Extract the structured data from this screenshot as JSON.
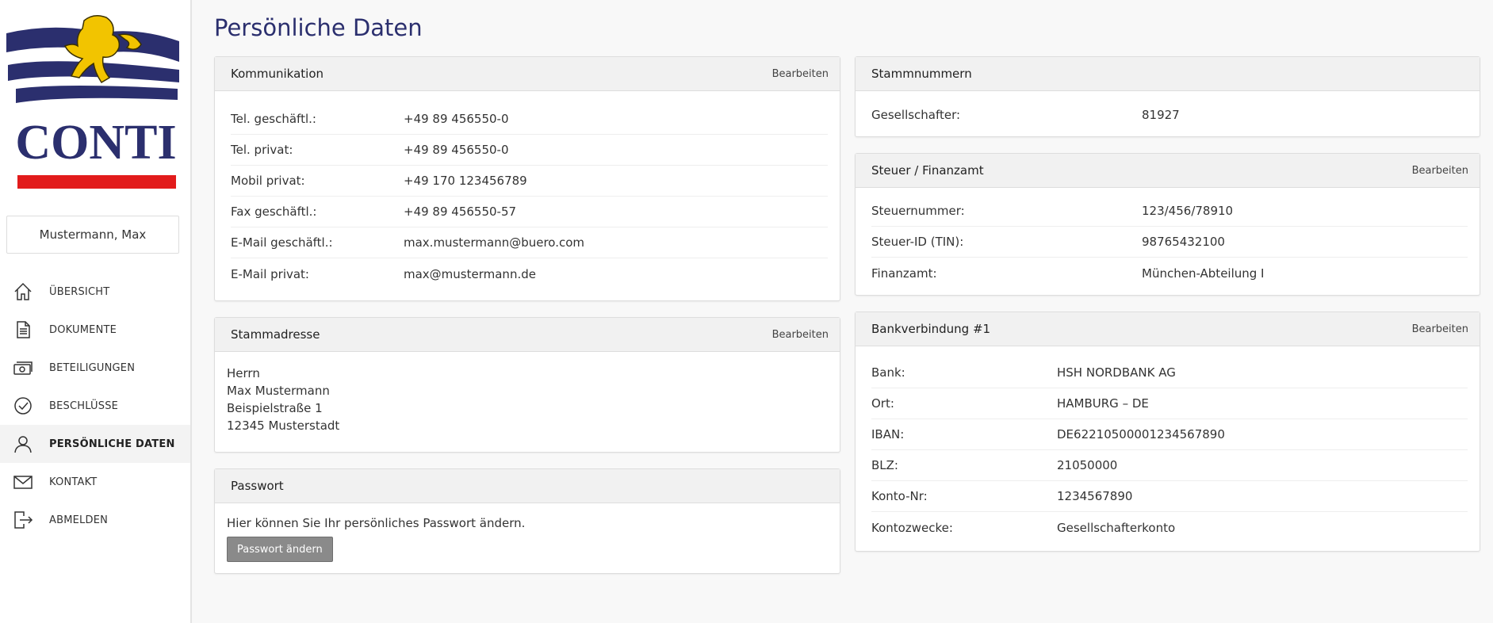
{
  "brand": {
    "name": "CONTI",
    "accent": "#2b2f6e",
    "red": "#e21b1b",
    "gold": "#f2c400"
  },
  "user": {
    "name": "Mustermann, Max"
  },
  "nav": [
    {
      "label": "ÜBERSICHT",
      "icon": "home-icon"
    },
    {
      "label": "DOKUMENTE",
      "icon": "document-icon"
    },
    {
      "label": "BETEILIGUNGEN",
      "icon": "money-icon"
    },
    {
      "label": "BESCHLÜSSE",
      "icon": "check-circle-icon"
    },
    {
      "label": "PERSÖNLICHE DATEN",
      "icon": "user-icon",
      "active": true
    },
    {
      "label": "KONTAKT",
      "icon": "mail-icon"
    },
    {
      "label": "ABMELDEN",
      "icon": "logout-icon"
    }
  ],
  "page": {
    "title": "Persönliche Daten"
  },
  "edit_label": "Bearbeiten",
  "kommunikation": {
    "title": "Kommunikation",
    "rows": [
      {
        "label": "Tel. geschäftl.:",
        "value": "+49 89 456550-0"
      },
      {
        "label": "Tel. privat:",
        "value": "+49 89 456550-0"
      },
      {
        "label": "Mobil privat:",
        "value": "+49 170 123456789"
      },
      {
        "label": "Fax geschäftl.:",
        "value": "+49 89 456550-57"
      },
      {
        "label": "E-Mail geschäftl.:",
        "value": "max.mustermann@buero.com"
      },
      {
        "label": "E-Mail privat:",
        "value": "max@mustermann.de"
      }
    ]
  },
  "stammadresse": {
    "title": "Stammadresse",
    "lines": [
      "Herrn",
      "Max Mustermann",
      "Beispielstraße 1",
      "12345 Musterstadt"
    ]
  },
  "passwort": {
    "title": "Passwort",
    "text": "Hier können Sie Ihr persönliches Passwort ändern.",
    "button": "Passwort ändern"
  },
  "stammnummern": {
    "title": "Stammnummern",
    "rows": [
      {
        "label": "Gesellschafter:",
        "value": "81927"
      }
    ]
  },
  "steuer": {
    "title": "Steuer / Finanzamt",
    "rows": [
      {
        "label": "Steuernummer:",
        "value": "123/456/78910"
      },
      {
        "label": "Steuer-ID (TIN):",
        "value": "98765432100"
      },
      {
        "label": "Finanzamt:",
        "value": "München-Abteilung I"
      }
    ]
  },
  "bank": {
    "title": "Bankverbindung #1",
    "rows": [
      {
        "label": "Bank:",
        "value": "HSH NORDBANK AG"
      },
      {
        "label": "Ort:",
        "value": "HAMBURG – DE"
      },
      {
        "label": "IBAN:",
        "value": "DE62210500001234567890"
      },
      {
        "label": "BLZ:",
        "value": "21050000"
      },
      {
        "label": "Konto-Nr:",
        "value": "1234567890"
      },
      {
        "label": "Kontozwecke:",
        "value": "Gesellschafterkonto"
      }
    ]
  }
}
